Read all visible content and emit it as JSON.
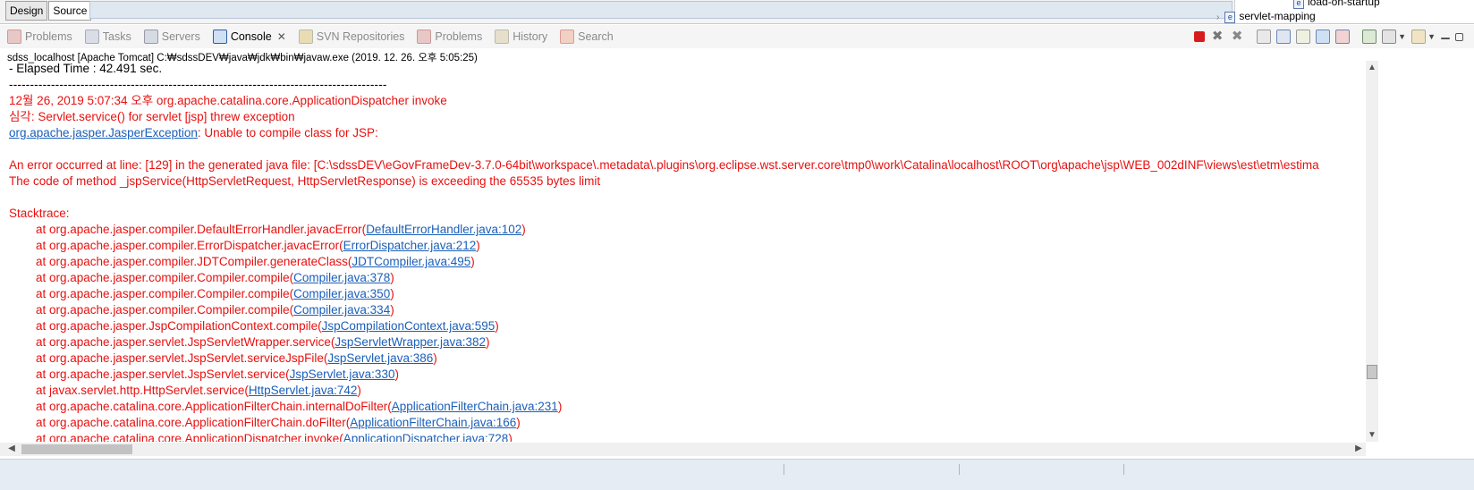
{
  "editor": {
    "tabs": [
      {
        "label": "Design",
        "active": false
      },
      {
        "label": "Source",
        "active": true
      }
    ]
  },
  "outline": {
    "items": [
      "load-on-startup",
      "servlet-mapping"
    ]
  },
  "view_tabs": [
    {
      "label": "Problems",
      "icon": "problems-icon",
      "active": false
    },
    {
      "label": "Tasks",
      "icon": "tasks-icon",
      "active": false
    },
    {
      "label": "Servers",
      "icon": "servers-icon",
      "active": false
    },
    {
      "label": "Console",
      "icon": "console-icon",
      "active": true,
      "close": "✕"
    },
    {
      "label": "SVN Repositories",
      "icon": "svn-repositories-icon",
      "active": false
    },
    {
      "label": "Problems",
      "icon": "problems-icon",
      "active": false
    },
    {
      "label": "History",
      "icon": "history-icon",
      "active": false
    },
    {
      "label": "Search",
      "icon": "search-icon",
      "active": false
    }
  ],
  "toolbar_icons": [
    "terminate-icon",
    "remove-launch-icon",
    "remove-all-terminated-icon",
    "clear-console-icon",
    "scroll-lock-icon",
    "word-wrap-icon",
    "show-on-stdout-icon",
    "show-on-stderr-icon",
    "pin-console-icon",
    "display-console-icon",
    "open-console-icon",
    "minimize-icon",
    "maximize-icon"
  ],
  "console": {
    "header": "sdss_localhost [Apache Tomcat] C:₩sdssDEV₩java₩jdk₩bin₩javaw.exe (2019. 12. 26. 오후 5:05:25)",
    "elapsed": " - Elapsed Time : 42.491 sec.",
    "separator": "------------------------------------------------------------------------------------------",
    "dispatcher_line": "12월 26, 2019 5:07:34 오후 org.apache.catalina.core.ApplicationDispatcher invoke",
    "severe_line": "심각: Servlet.service() for servlet [jsp] threw exception",
    "exception_class": "org.apache.jasper.JasperException",
    "exception_msg": ": Unable to compile class for JSP:",
    "error_line": "An error occurred at line: [129] in the generated java file: [C:\\sdssDEV\\eGovFrameDev-3.7.0-64bit\\workspace\\.metadata\\.plugins\\org.eclipse.wst.server.core\\tmp0\\work\\Catalina\\localhost\\ROOT\\org\\apache\\jsp\\WEB_002dINF\\views\\est\\etm\\estima",
    "code_line": "The code of method _jspService(HttpServletRequest, HttpServletResponse) is exceeding the 65535 bytes limit",
    "stacktrace_label": "Stacktrace:",
    "stack": [
      {
        "method": "at org.apache.jasper.compiler.DefaultErrorHandler.javacError(",
        "link": "DefaultErrorHandler.java:102"
      },
      {
        "method": "at org.apache.jasper.compiler.ErrorDispatcher.javacError(",
        "link": "ErrorDispatcher.java:212"
      },
      {
        "method": "at org.apache.jasper.compiler.JDTCompiler.generateClass(",
        "link": "JDTCompiler.java:495"
      },
      {
        "method": "at org.apache.jasper.compiler.Compiler.compile(",
        "link": "Compiler.java:378"
      },
      {
        "method": "at org.apache.jasper.compiler.Compiler.compile(",
        "link": "Compiler.java:350"
      },
      {
        "method": "at org.apache.jasper.compiler.Compiler.compile(",
        "link": "Compiler.java:334"
      },
      {
        "method": "at org.apache.jasper.JspCompilationContext.compile(",
        "link": "JspCompilationContext.java:595"
      },
      {
        "method": "at org.apache.jasper.servlet.JspServletWrapper.service(",
        "link": "JspServletWrapper.java:382"
      },
      {
        "method": "at org.apache.jasper.servlet.JspServlet.serviceJspFile(",
        "link": "JspServlet.java:386"
      },
      {
        "method": "at org.apache.jasper.servlet.JspServlet.service(",
        "link": "JspServlet.java:330"
      },
      {
        "method": "at javax.servlet.http.HttpServlet.service(",
        "link": "HttpServlet.java:742"
      },
      {
        "method": "at org.apache.catalina.core.ApplicationFilterChain.internalDoFilter(",
        "link": "ApplicationFilterChain.java:231"
      },
      {
        "method": "at org.apache.catalina.core.ApplicationFilterChain.doFilter(",
        "link": "ApplicationFilterChain.java:166"
      },
      {
        "method": "at org.apache.catalina.core.ApplicationDispatcher.invoke(",
        "link": "ApplicationDispatcher.java:728"
      }
    ],
    "stack_close": ")"
  },
  "colors": {
    "error": "#e81010",
    "link": "#1b5fb9",
    "stdout": "#000000"
  }
}
